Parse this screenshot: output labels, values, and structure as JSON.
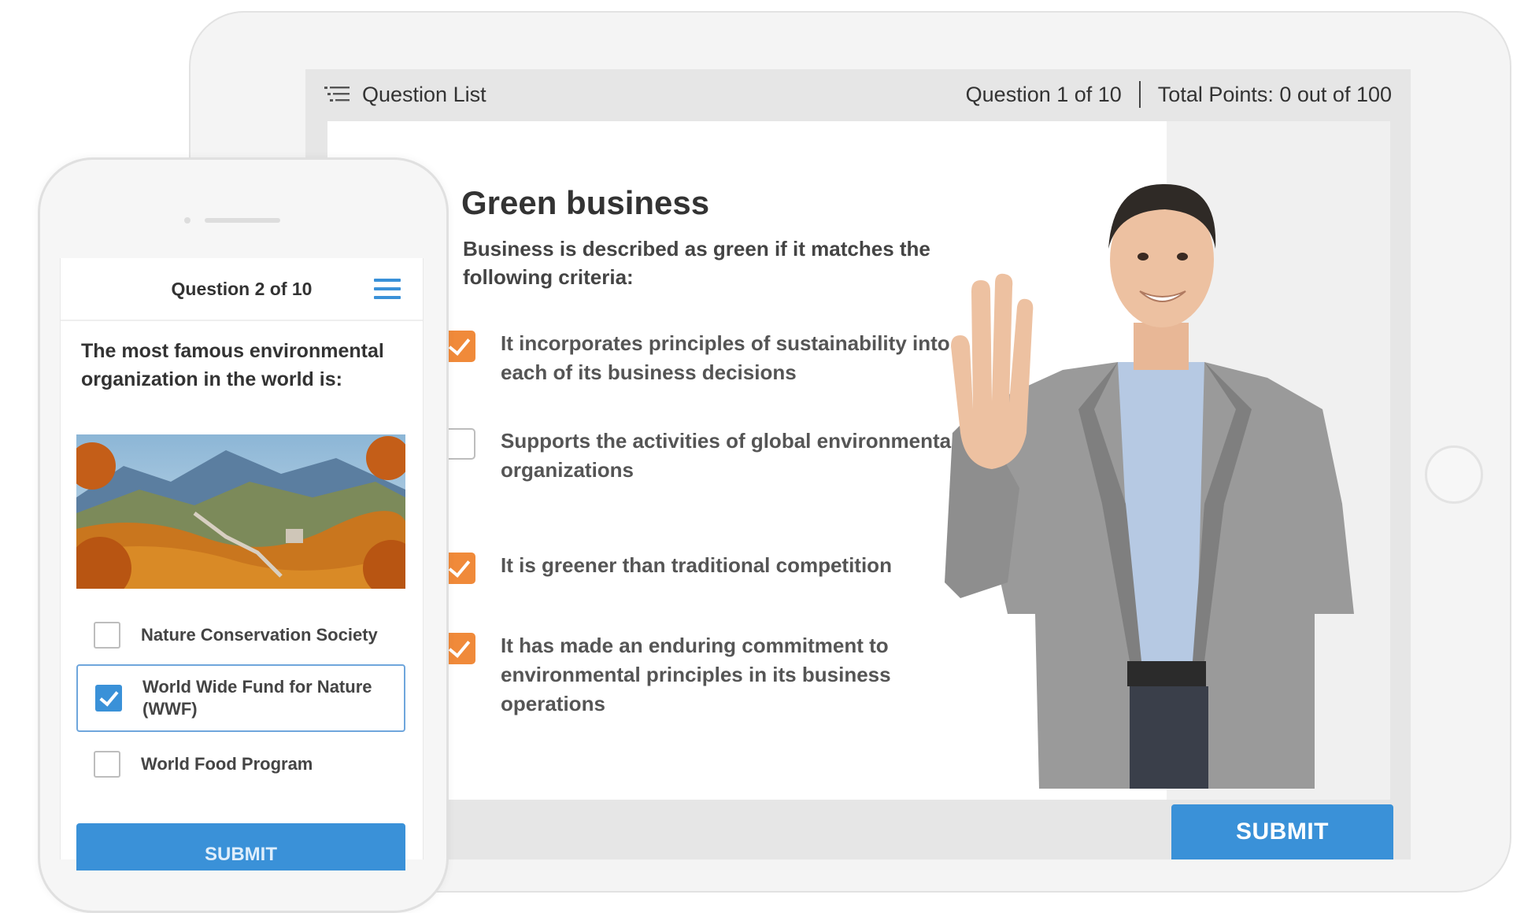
{
  "tablet": {
    "topbar": {
      "question_list_label": "Question List",
      "question_counter": "Question 1 of 10",
      "total_points": "Total Points: 0 out of 100"
    },
    "question": {
      "title": "Green business",
      "text": "Business is described as green if it matches the following criteria:",
      "options": [
        {
          "label": "It incorporates principles of sustainability into each of its business decisions",
          "checked": true
        },
        {
          "label": "Supports the activities of global environmental organizations",
          "checked": false
        },
        {
          "label": "It is greener than traditional competition",
          "checked": true
        },
        {
          "label": "It has made an enduring commitment to environmental principles in its business operations",
          "checked": true
        }
      ]
    },
    "submit_label": "SUBMIT"
  },
  "phone": {
    "question_counter": "Question 2 of 10",
    "question_text": "The most famous environmental organization in the world is:",
    "options": [
      {
        "label": "Nature Conservation Society",
        "checked": false
      },
      {
        "label": "World Wide Fund for Nature (WWF)",
        "checked": true
      },
      {
        "label": "World Food Program",
        "checked": false
      }
    ],
    "submit_label": "SUBMIT"
  },
  "colors": {
    "accent_blue": "#3a91d8",
    "accent_orange": "#f08a3a"
  }
}
